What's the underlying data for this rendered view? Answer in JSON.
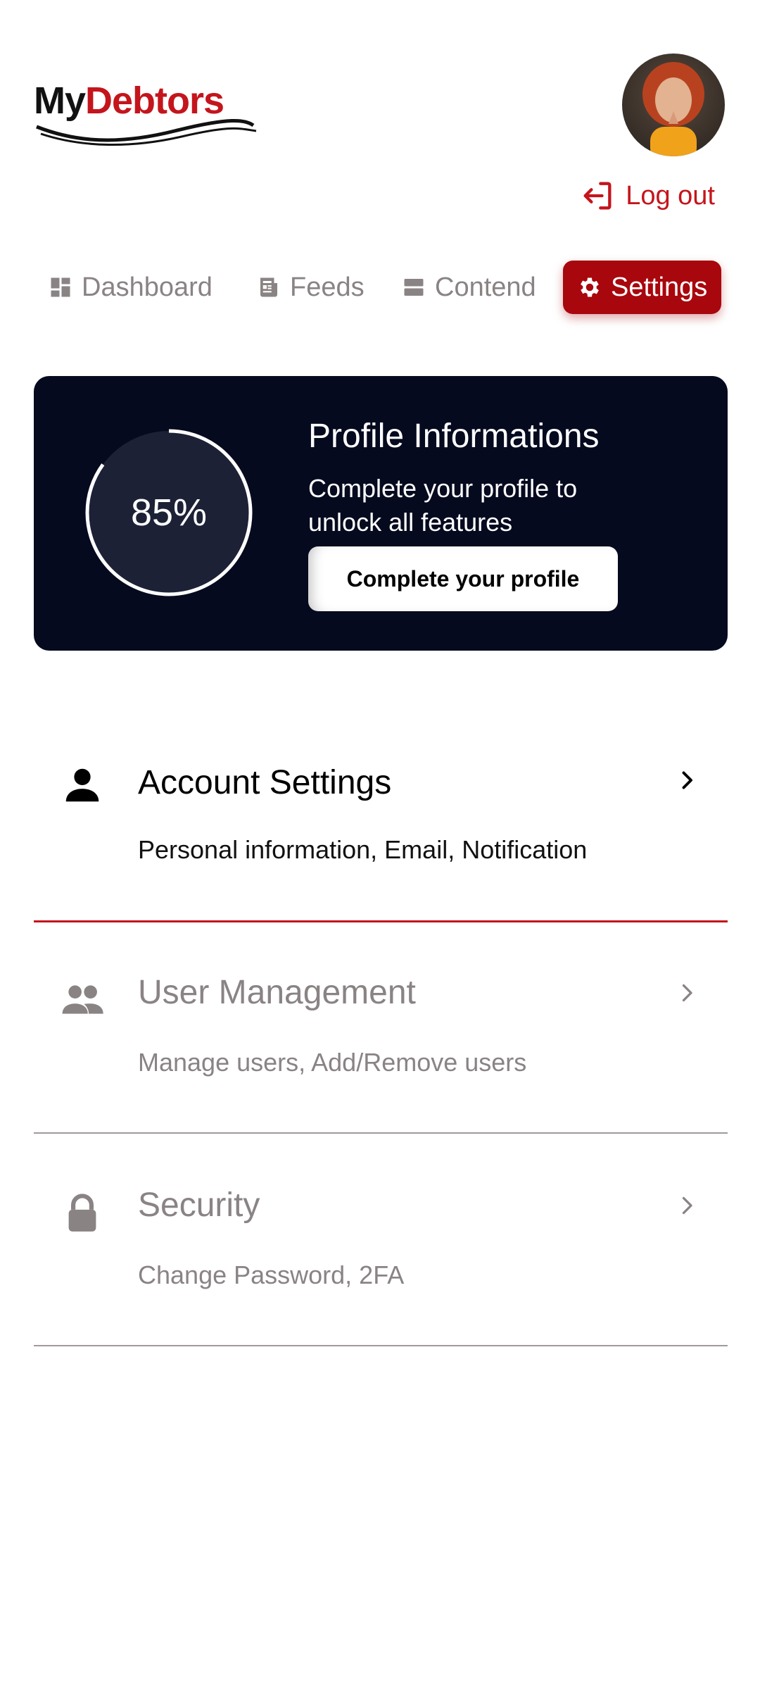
{
  "app": {
    "logo_my": "My",
    "logo_debtors": "Debtors",
    "logout_label": "Log out"
  },
  "tabs": [
    {
      "label": "Dashboard",
      "icon": "dashboard-icon",
      "active": false
    },
    {
      "label": "Feeds",
      "icon": "feeds-icon",
      "active": false
    },
    {
      "label": "Contend",
      "icon": "content-icon",
      "active": false
    },
    {
      "label": "Settings",
      "icon": "gear-icon",
      "active": true
    }
  ],
  "profile_card": {
    "progress_percent": 85,
    "progress_label": "85%",
    "title": "Profile Informations",
    "subtitle": "Complete your profile to unlock all features",
    "button_label": "Complete your profile"
  },
  "settings": [
    {
      "label": "Account Settings",
      "description": "Personal information, Email, Notification",
      "icon": "person-icon",
      "active": true
    },
    {
      "label": "User Management",
      "description": "Manage users, Add/Remove users",
      "icon": "users-icon",
      "active": false
    },
    {
      "label": "Security",
      "description": "Change Password, 2FA",
      "icon": "lock-icon",
      "active": false
    }
  ],
  "colors": {
    "brand_red": "#c4151c",
    "active_tab": "#a8070d",
    "card_bg": "#050a1f",
    "muted": "#8a8384"
  }
}
